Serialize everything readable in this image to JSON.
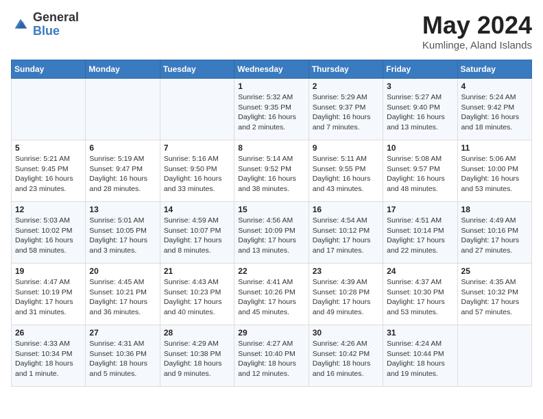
{
  "header": {
    "logo_general": "General",
    "logo_blue": "Blue",
    "title": "May 2024",
    "subtitle": "Kumlinge, Aland Islands"
  },
  "weekdays": [
    "Sunday",
    "Monday",
    "Tuesday",
    "Wednesday",
    "Thursday",
    "Friday",
    "Saturday"
  ],
  "weeks": [
    [
      {
        "day": "",
        "info": ""
      },
      {
        "day": "",
        "info": ""
      },
      {
        "day": "",
        "info": ""
      },
      {
        "day": "1",
        "info": "Sunrise: 5:32 AM\nSunset: 9:35 PM\nDaylight: 16 hours\nand 2 minutes."
      },
      {
        "day": "2",
        "info": "Sunrise: 5:29 AM\nSunset: 9:37 PM\nDaylight: 16 hours\nand 7 minutes."
      },
      {
        "day": "3",
        "info": "Sunrise: 5:27 AM\nSunset: 9:40 PM\nDaylight: 16 hours\nand 13 minutes."
      },
      {
        "day": "4",
        "info": "Sunrise: 5:24 AM\nSunset: 9:42 PM\nDaylight: 16 hours\nand 18 minutes."
      }
    ],
    [
      {
        "day": "5",
        "info": "Sunrise: 5:21 AM\nSunset: 9:45 PM\nDaylight: 16 hours\nand 23 minutes."
      },
      {
        "day": "6",
        "info": "Sunrise: 5:19 AM\nSunset: 9:47 PM\nDaylight: 16 hours\nand 28 minutes."
      },
      {
        "day": "7",
        "info": "Sunrise: 5:16 AM\nSunset: 9:50 PM\nDaylight: 16 hours\nand 33 minutes."
      },
      {
        "day": "8",
        "info": "Sunrise: 5:14 AM\nSunset: 9:52 PM\nDaylight: 16 hours\nand 38 minutes."
      },
      {
        "day": "9",
        "info": "Sunrise: 5:11 AM\nSunset: 9:55 PM\nDaylight: 16 hours\nand 43 minutes."
      },
      {
        "day": "10",
        "info": "Sunrise: 5:08 AM\nSunset: 9:57 PM\nDaylight: 16 hours\nand 48 minutes."
      },
      {
        "day": "11",
        "info": "Sunrise: 5:06 AM\nSunset: 10:00 PM\nDaylight: 16 hours\nand 53 minutes."
      }
    ],
    [
      {
        "day": "12",
        "info": "Sunrise: 5:03 AM\nSunset: 10:02 PM\nDaylight: 16 hours\nand 58 minutes."
      },
      {
        "day": "13",
        "info": "Sunrise: 5:01 AM\nSunset: 10:05 PM\nDaylight: 17 hours\nand 3 minutes."
      },
      {
        "day": "14",
        "info": "Sunrise: 4:59 AM\nSunset: 10:07 PM\nDaylight: 17 hours\nand 8 minutes."
      },
      {
        "day": "15",
        "info": "Sunrise: 4:56 AM\nSunset: 10:09 PM\nDaylight: 17 hours\nand 13 minutes."
      },
      {
        "day": "16",
        "info": "Sunrise: 4:54 AM\nSunset: 10:12 PM\nDaylight: 17 hours\nand 17 minutes."
      },
      {
        "day": "17",
        "info": "Sunrise: 4:51 AM\nSunset: 10:14 PM\nDaylight: 17 hours\nand 22 minutes."
      },
      {
        "day": "18",
        "info": "Sunrise: 4:49 AM\nSunset: 10:16 PM\nDaylight: 17 hours\nand 27 minutes."
      }
    ],
    [
      {
        "day": "19",
        "info": "Sunrise: 4:47 AM\nSunset: 10:19 PM\nDaylight: 17 hours\nand 31 minutes."
      },
      {
        "day": "20",
        "info": "Sunrise: 4:45 AM\nSunset: 10:21 PM\nDaylight: 17 hours\nand 36 minutes."
      },
      {
        "day": "21",
        "info": "Sunrise: 4:43 AM\nSunset: 10:23 PM\nDaylight: 17 hours\nand 40 minutes."
      },
      {
        "day": "22",
        "info": "Sunrise: 4:41 AM\nSunset: 10:26 PM\nDaylight: 17 hours\nand 45 minutes."
      },
      {
        "day": "23",
        "info": "Sunrise: 4:39 AM\nSunset: 10:28 PM\nDaylight: 17 hours\nand 49 minutes."
      },
      {
        "day": "24",
        "info": "Sunrise: 4:37 AM\nSunset: 10:30 PM\nDaylight: 17 hours\nand 53 minutes."
      },
      {
        "day": "25",
        "info": "Sunrise: 4:35 AM\nSunset: 10:32 PM\nDaylight: 17 hours\nand 57 minutes."
      }
    ],
    [
      {
        "day": "26",
        "info": "Sunrise: 4:33 AM\nSunset: 10:34 PM\nDaylight: 18 hours\nand 1 minute."
      },
      {
        "day": "27",
        "info": "Sunrise: 4:31 AM\nSunset: 10:36 PM\nDaylight: 18 hours\nand 5 minutes."
      },
      {
        "day": "28",
        "info": "Sunrise: 4:29 AM\nSunset: 10:38 PM\nDaylight: 18 hours\nand 9 minutes."
      },
      {
        "day": "29",
        "info": "Sunrise: 4:27 AM\nSunset: 10:40 PM\nDaylight: 18 hours\nand 12 minutes."
      },
      {
        "day": "30",
        "info": "Sunrise: 4:26 AM\nSunset: 10:42 PM\nDaylight: 18 hours\nand 16 minutes."
      },
      {
        "day": "31",
        "info": "Sunrise: 4:24 AM\nSunset: 10:44 PM\nDaylight: 18 hours\nand 19 minutes."
      },
      {
        "day": "",
        "info": ""
      }
    ]
  ]
}
